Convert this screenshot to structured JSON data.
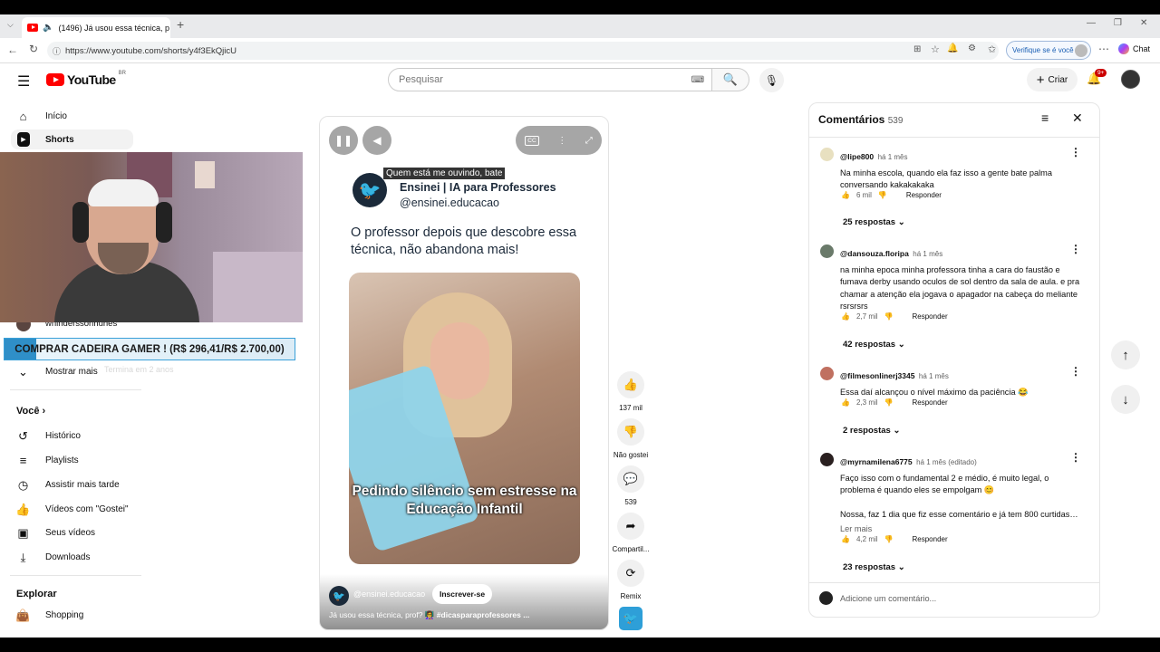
{
  "browser": {
    "tab_title": "(1496) Já usou essa técnica, p",
    "url": "https://www.youtube.com/shorts/y4f3EkQjicU",
    "verify_label": "Verifique se é você",
    "chat_label": "Chat"
  },
  "youtube": {
    "logo_text": "YouTube",
    "country": "BR",
    "search_placeholder": "Pesquisar",
    "create_label": "Criar",
    "notifications": "9+"
  },
  "sidebar": {
    "home": "Início",
    "shorts": "Shorts",
    "subscription_channel": "whinderssonnunes",
    "show_more": "Mostrar mais",
    "you_heading": "Você",
    "history": "Histórico",
    "playlists": "Playlists",
    "watch_later": "Assistir mais tarde",
    "liked": "Vídeos com \"Gostei\"",
    "your_videos": "Seus vídeos",
    "downloads": "Downloads",
    "explore_heading": "Explorar",
    "shopping": "Shopping"
  },
  "overlay": {
    "banner": "COMPRAR CADEIRA GAMER ! (R$ 296,41/R$ 2.700,00)",
    "ghost_text": "Termina em 2 anos"
  },
  "video": {
    "caption": "Quem está me ouvindo, bate",
    "account_title": "Ensinei | IA para Professores",
    "account_handle": "@ensinei.educacao",
    "headline": "O professor depois que descobre essa técnica, não abandona mais!",
    "overlay_text": "Pedindo silêncio  sem estresse na Educação Infantil",
    "channel": "@ensinei.educacao",
    "subscribe_label": "Inscrever-se",
    "description": "Já usou essa técnica, prof? 👩‍🏫 ",
    "hashtag": "#dicasparaprofessores ..."
  },
  "actions": {
    "likes": "137 mil",
    "dislike": "Não gostei",
    "comments": "539",
    "share": "Compartil...",
    "remix": "Remix"
  },
  "comments": {
    "title": "Comentários",
    "count": "539",
    "reply_label": "Responder",
    "add_placeholder": "Adicione um comentário...",
    "list": [
      {
        "user": "@lipe800",
        "time": "há 1 mês",
        "text": "Na minha escola, quando ela faz isso a gente bate palma conversando kakakakaka",
        "likes": "6 mil",
        "replies": "25 respostas"
      },
      {
        "user": "@dansouza.floripa",
        "time": "há 1 mês",
        "text": "na minha epoca minha professora tinha a cara do faustão e fumava derby usando oculos de sol dentro da sala de aula. e pra chamar a atenção ela jogava o apagador na cabeça do meliante rsrsrsrs",
        "likes": "2,7 mil",
        "replies": "42 respostas"
      },
      {
        "user": "@filmesonlinerj3345",
        "time": "há 1 mês",
        "text": "Essa daí alcançou o nível máximo da paciência 😂",
        "likes": "2,3 mil",
        "replies": "2 respostas"
      },
      {
        "user": "@myrnamilena6775",
        "time": "há 1 mês (editado)",
        "text": "Faço isso com o fundamental 2 e médio, é muito legal, o problema é quando eles se empolgam 😊",
        "text2": "Nossa, faz 1 dia que fiz esse comentário e já tem 800 curtidas …",
        "read_more": "Ler mais",
        "likes": "4,2 mil",
        "replies": "23 respostas"
      }
    ]
  }
}
